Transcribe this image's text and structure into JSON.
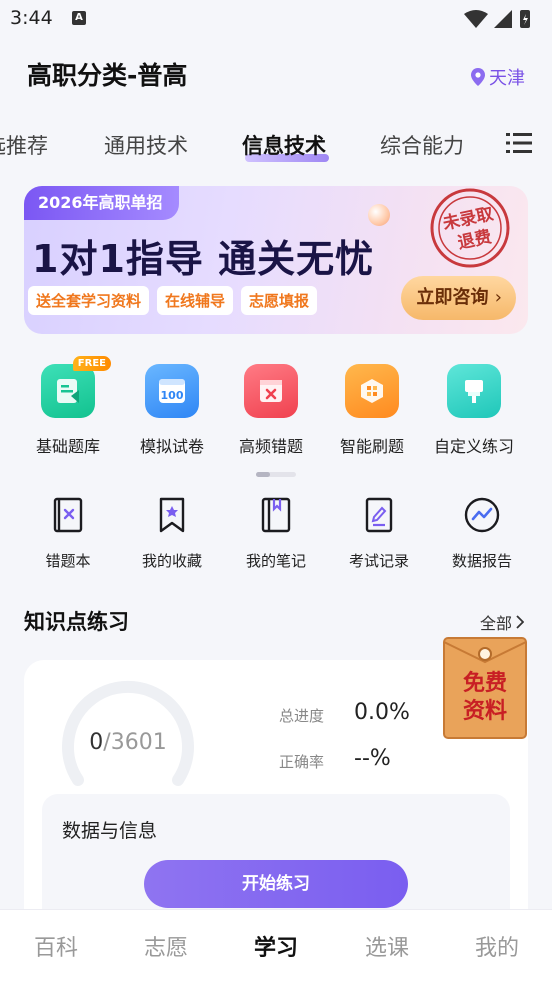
{
  "status_bar": {
    "time": "3:44",
    "notification_letter": "A"
  },
  "header": {
    "title": "高职分类-普高",
    "location": "天津"
  },
  "tabs": [
    {
      "label": "精选推荐"
    },
    {
      "label": "通用技术"
    },
    {
      "label": "信息技术"
    },
    {
      "label": "综合能力"
    }
  ],
  "active_tab": "信息技术",
  "banner": {
    "tag": "2026年高职单招",
    "headline": "1对1指导  通关无忧",
    "pills": [
      "送全套学习资料",
      "在线辅导",
      "志愿填报"
    ],
    "cta": "立即咨询",
    "stamp_line1": "未录取",
    "stamp_line2": "退费"
  },
  "features": [
    {
      "label": "基础题库",
      "badge": "FREE"
    },
    {
      "label": "模拟试卷",
      "icon_text": "100"
    },
    {
      "label": "高频错题"
    },
    {
      "label": "智能刷题"
    },
    {
      "label": "自定义练习"
    }
  ],
  "tools": [
    {
      "label": "错题本"
    },
    {
      "label": "我的收藏"
    },
    {
      "label": "我的笔记"
    },
    {
      "label": "考试记录"
    },
    {
      "label": "数据报告"
    }
  ],
  "section": {
    "title": "知识点练习",
    "more": "全部"
  },
  "practice_card": {
    "done": "0",
    "total": "/3601",
    "progress_label": "总进度",
    "progress_value": "0.0%",
    "accuracy_label": "正确率",
    "accuracy_value": "--%",
    "subject": "数据与信息",
    "start_button": "开始练习"
  },
  "free_packet": {
    "line1": "免费",
    "line2": "资料"
  },
  "bottom_nav": [
    {
      "label": "百科"
    },
    {
      "label": "志愿"
    },
    {
      "label": "学习"
    },
    {
      "label": "选课"
    },
    {
      "label": "我的"
    }
  ],
  "active_nav": "学习",
  "colors": {
    "accent": "#7a5ef0",
    "cta": "#f6b86a",
    "pill_text": "#f0781e"
  }
}
